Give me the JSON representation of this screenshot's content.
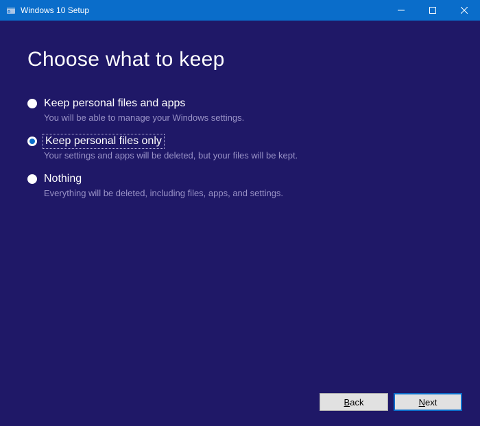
{
  "window": {
    "title": "Windows 10 Setup"
  },
  "page": {
    "heading": "Choose what to keep"
  },
  "options": [
    {
      "label": "Keep personal files and apps",
      "description": "You will be able to manage your Windows settings.",
      "selected": false
    },
    {
      "label": "Keep personal files only",
      "description": "Your settings and apps will be deleted, but your files will be kept.",
      "selected": true
    },
    {
      "label": "Nothing",
      "description": "Everything will be deleted, including files, apps, and settings.",
      "selected": false
    }
  ],
  "buttons": {
    "back": "Back",
    "next": "Next"
  }
}
